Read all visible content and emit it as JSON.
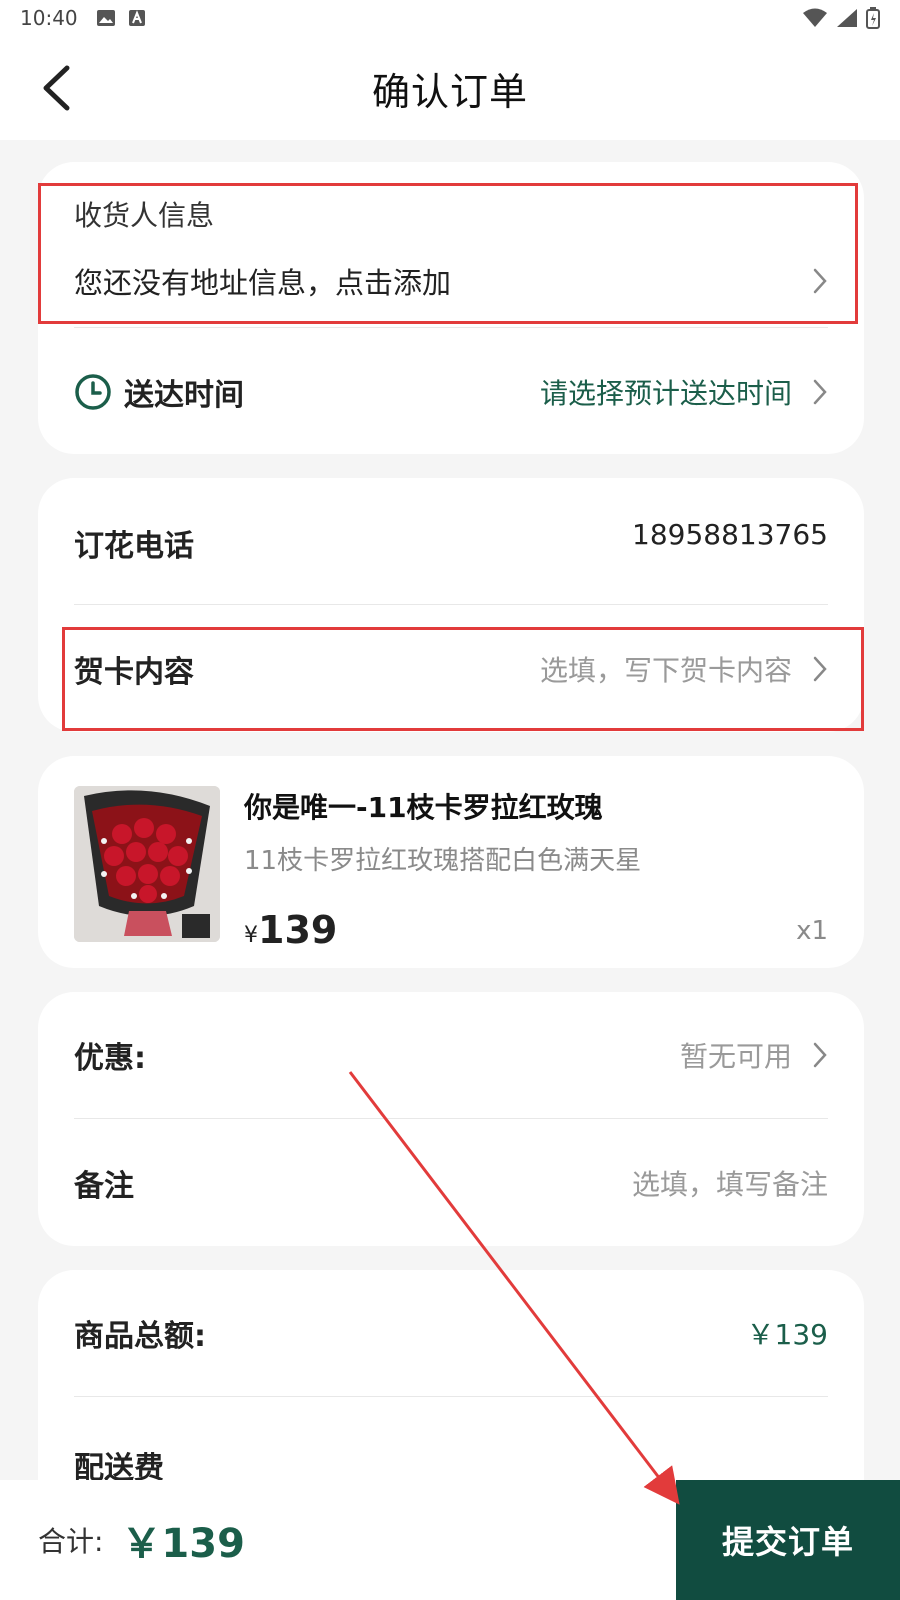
{
  "status": {
    "time": "10:40"
  },
  "header": {
    "title": "确认订单"
  },
  "receiver": {
    "section_title": "收货人信息",
    "empty_text": "您还没有地址信息，点击添加"
  },
  "delivery": {
    "label": "送达时间",
    "value": "请选择预计送达时间"
  },
  "order_phone": {
    "label": "订花电话",
    "value": "18958813765"
  },
  "card_message": {
    "label": "贺卡内容",
    "placeholder": "选填，写下贺卡内容"
  },
  "product": {
    "name": "你是唯一-11枝卡罗拉红玫瑰",
    "desc": "11枝卡罗拉红玫瑰搭配白色满天星",
    "currency": "¥",
    "price": "139",
    "qty": "x1"
  },
  "discount": {
    "label": "优惠:",
    "value": "暂无可用"
  },
  "remark": {
    "label": "备注",
    "placeholder": "选填，填写备注"
  },
  "summary": {
    "goods_total_label": "商品总额:",
    "goods_total_value": "￥139",
    "shipping_label": "配送费"
  },
  "footer": {
    "total_label": "合计:",
    "total_value": "￥139",
    "submit_label": "提交订单"
  },
  "colors": {
    "accent": "#1b5e4a",
    "submit_bg": "#114c40",
    "annotation_red": "#e23b3b"
  }
}
